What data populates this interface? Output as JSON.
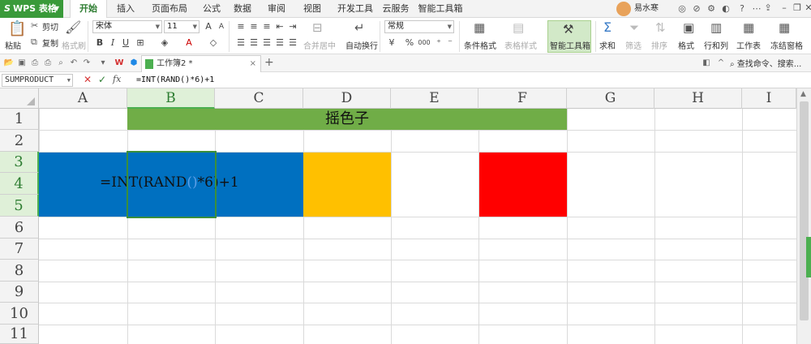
{
  "app": {
    "name": "WPS 表格",
    "logo": "S"
  },
  "menu_tabs": [
    {
      "label": "开始",
      "active": true
    },
    {
      "label": "插入",
      "active": false
    },
    {
      "label": "页面布局",
      "active": false
    },
    {
      "label": "公式",
      "active": false
    },
    {
      "label": "数据",
      "active": false
    },
    {
      "label": "审阅",
      "active": false
    },
    {
      "label": "视图",
      "active": false
    },
    {
      "label": "开发工具",
      "active": false
    },
    {
      "label": "云服务",
      "active": false
    },
    {
      "label": "智能工具箱",
      "active": false
    }
  ],
  "user": {
    "name": "易水寒"
  },
  "ribbon": {
    "paste": "粘贴",
    "cut": "剪切",
    "copy": "复制",
    "format_painter": "格式刷",
    "font_family": "宋体",
    "font_size": "11",
    "merge_center": "合并居中",
    "wrap_text": "自动换行",
    "number_format": "常规",
    "conditional_format": "条件格式",
    "table_style": "表格样式",
    "smart_toolbox": "智能工具箱",
    "sum": "求和",
    "filter": "筛选",
    "sort": "排序",
    "format": "格式",
    "row_col": "行和列",
    "worksheet": "工作表",
    "freeze": "冻结窗格",
    "percent": "%",
    "thousands": "000"
  },
  "document_tab": {
    "label": "工作簿2 *",
    "close": "×",
    "add": "+"
  },
  "search_cmd": "查找命令、搜索...",
  "formula_bar": {
    "name_box": "SUMPRODUCT",
    "cancel": "✕",
    "confirm": "✓",
    "fx": "fx",
    "formula": "=INT(RAND()*6)+1"
  },
  "columns": [
    "A",
    "B",
    "C",
    "D",
    "E",
    "F",
    "G",
    "H",
    "I"
  ],
  "selected_column": "B",
  "rows": [
    "1",
    "2",
    "3",
    "4",
    "5",
    "6",
    "7",
    "8",
    "9",
    "10",
    "11"
  ],
  "selected_rows": [
    "3",
    "4",
    "5"
  ],
  "cells": {
    "title": "摇色子",
    "formula_part1": "=INT(RAND",
    "formula_paren": "()",
    "formula_part2": "*6)+1"
  },
  "colors": {
    "green_header": "#70ad47",
    "blue_block": "#0070c0",
    "yellow_block": "#ffc000",
    "red_block": "#ff0000",
    "accent": "#3a9a3a"
  }
}
